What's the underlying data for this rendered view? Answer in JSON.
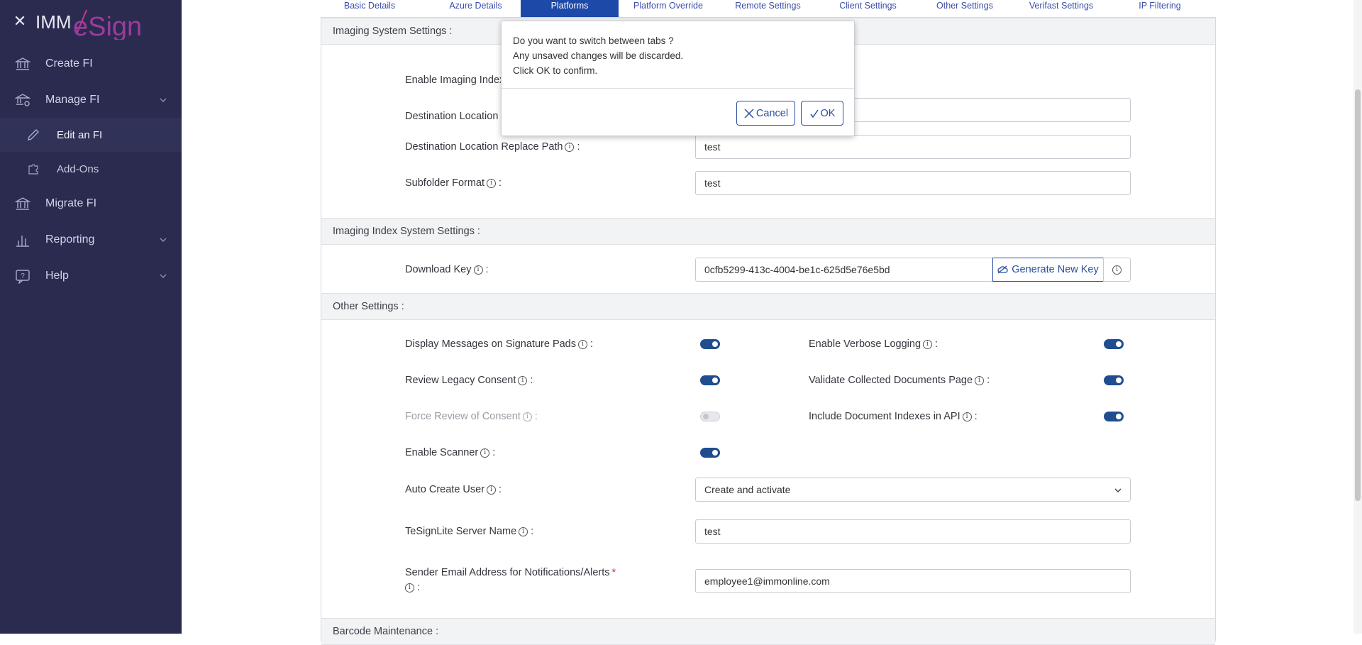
{
  "sidebar": {
    "logo_prefix": "IMM",
    "logo_suffix": "eSign",
    "items": {
      "create_fi": "Create FI",
      "manage_fi": "Manage FI",
      "edit_fi": "Edit an FI",
      "add_ons": "Add-Ons",
      "migrate_fi": "Migrate FI",
      "reporting": "Reporting",
      "help": "Help"
    }
  },
  "tabs": {
    "basic": "Basic Details",
    "azure": "Azure Details",
    "platforms": "Platforms",
    "platform_override": "Platform Override",
    "remote": "Remote Settings",
    "client": "Client Settings",
    "other": "Other Settings",
    "verifast": "Verifast Settings",
    "ip": "IP Filtering"
  },
  "imaging_system": {
    "header": "Imaging System Settings :",
    "enable_index": "Enable Imaging Index",
    "dest_location": "Destination Location",
    "dest_replace": "Destination Location Replace Path",
    "dest_replace_value": "test",
    "subfolder": "Subfolder Format",
    "subfolder_value": "test"
  },
  "imaging_index": {
    "header": "Imaging Index System Settings :",
    "download_key": "Download Key",
    "download_key_value": "0cfb5299-413c-4004-be1c-625d5e76e5bd",
    "generate_button": "Generate New Key"
  },
  "other_settings": {
    "header": "Other Settings :",
    "display_messages": "Display Messages on Signature Pads",
    "verbose_logging": "Enable Verbose Logging",
    "review_legacy": "Review Legacy Consent",
    "validate_docs": "Validate Collected Documents Page",
    "force_review": "Force Review of Consent",
    "include_indexes": "Include Document Indexes in API",
    "enable_scanner": "Enable Scanner",
    "auto_create_user": "Auto Create User",
    "auto_create_user_value": "Create and activate",
    "server_name": "TeSignLite Server Name",
    "server_name_value": "test",
    "sender_email": "Sender Email Address for Notifications/Alerts",
    "sender_email_value": "employee1@immonline.com",
    "colon": ":",
    "required_mark": "*"
  },
  "barcode": {
    "header": "Barcode Maintenance :"
  },
  "modal": {
    "line1": "Do you want to switch between tabs ?",
    "line2": "Any unsaved changes will be discarded.",
    "line3": "Click OK to confirm.",
    "cancel": "Cancel",
    "ok": "OK"
  },
  "colors": {
    "sidebar_bg": "#2a2b4f",
    "accent": "#1d4aa8",
    "toggle_on": "#1f4d8f"
  }
}
